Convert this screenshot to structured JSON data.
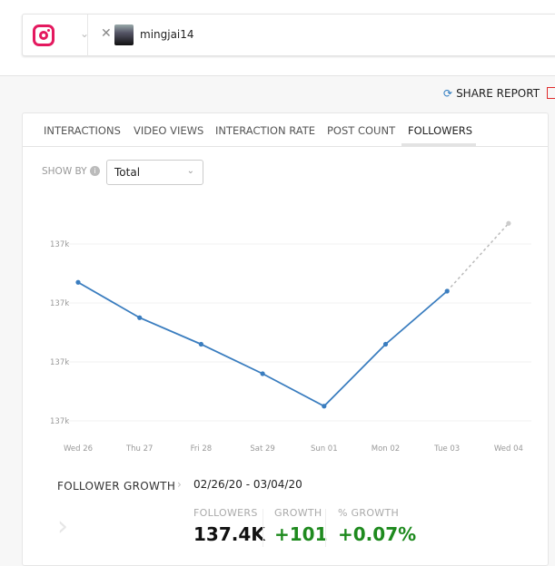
{
  "header": {
    "account": "mingjai14",
    "platform_icon": "instagram-icon"
  },
  "share_label": "SHARE REPORT",
  "tabs": [
    "INTERACTIONS",
    "VIDEO VIEWS",
    "INTERACTION RATE",
    "POST COUNT",
    "FOLLOWERS"
  ],
  "active_tab": "FOLLOWERS",
  "show_by": {
    "label": "SHOW BY",
    "value": "Total"
  },
  "chart_data": {
    "type": "line",
    "categories": [
      "Wed 26",
      "Thu 27",
      "Fri 28",
      "Sat 29",
      "Sun 01",
      "Mon 02",
      "Tue 03",
      "Wed 04"
    ],
    "values": [
      137387,
      137375,
      137366,
      137356,
      137345,
      137366,
      137384,
      137407
    ],
    "projected_from_index": 6,
    "y_ticks": [
      137340,
      137360,
      137380,
      137400
    ],
    "y_tick_labels": [
      "137k",
      "137k",
      "137k",
      "137k"
    ],
    "ylim": [
      137340,
      137400
    ],
    "grid": true,
    "color": "#3a7dbf"
  },
  "summary": {
    "title": "FOLLOWER GROWTH",
    "range": "02/26/20 - 03/04/20",
    "stats": [
      {
        "label": "FOLLOWERS",
        "value": "137.4K",
        "color": "#111111"
      },
      {
        "label": "GROWTH",
        "value": "+101",
        "color": "#1e8a1e"
      },
      {
        "label": "% GROWTH",
        "value": "+0.07%",
        "color": "#1e8a1e"
      }
    ]
  }
}
